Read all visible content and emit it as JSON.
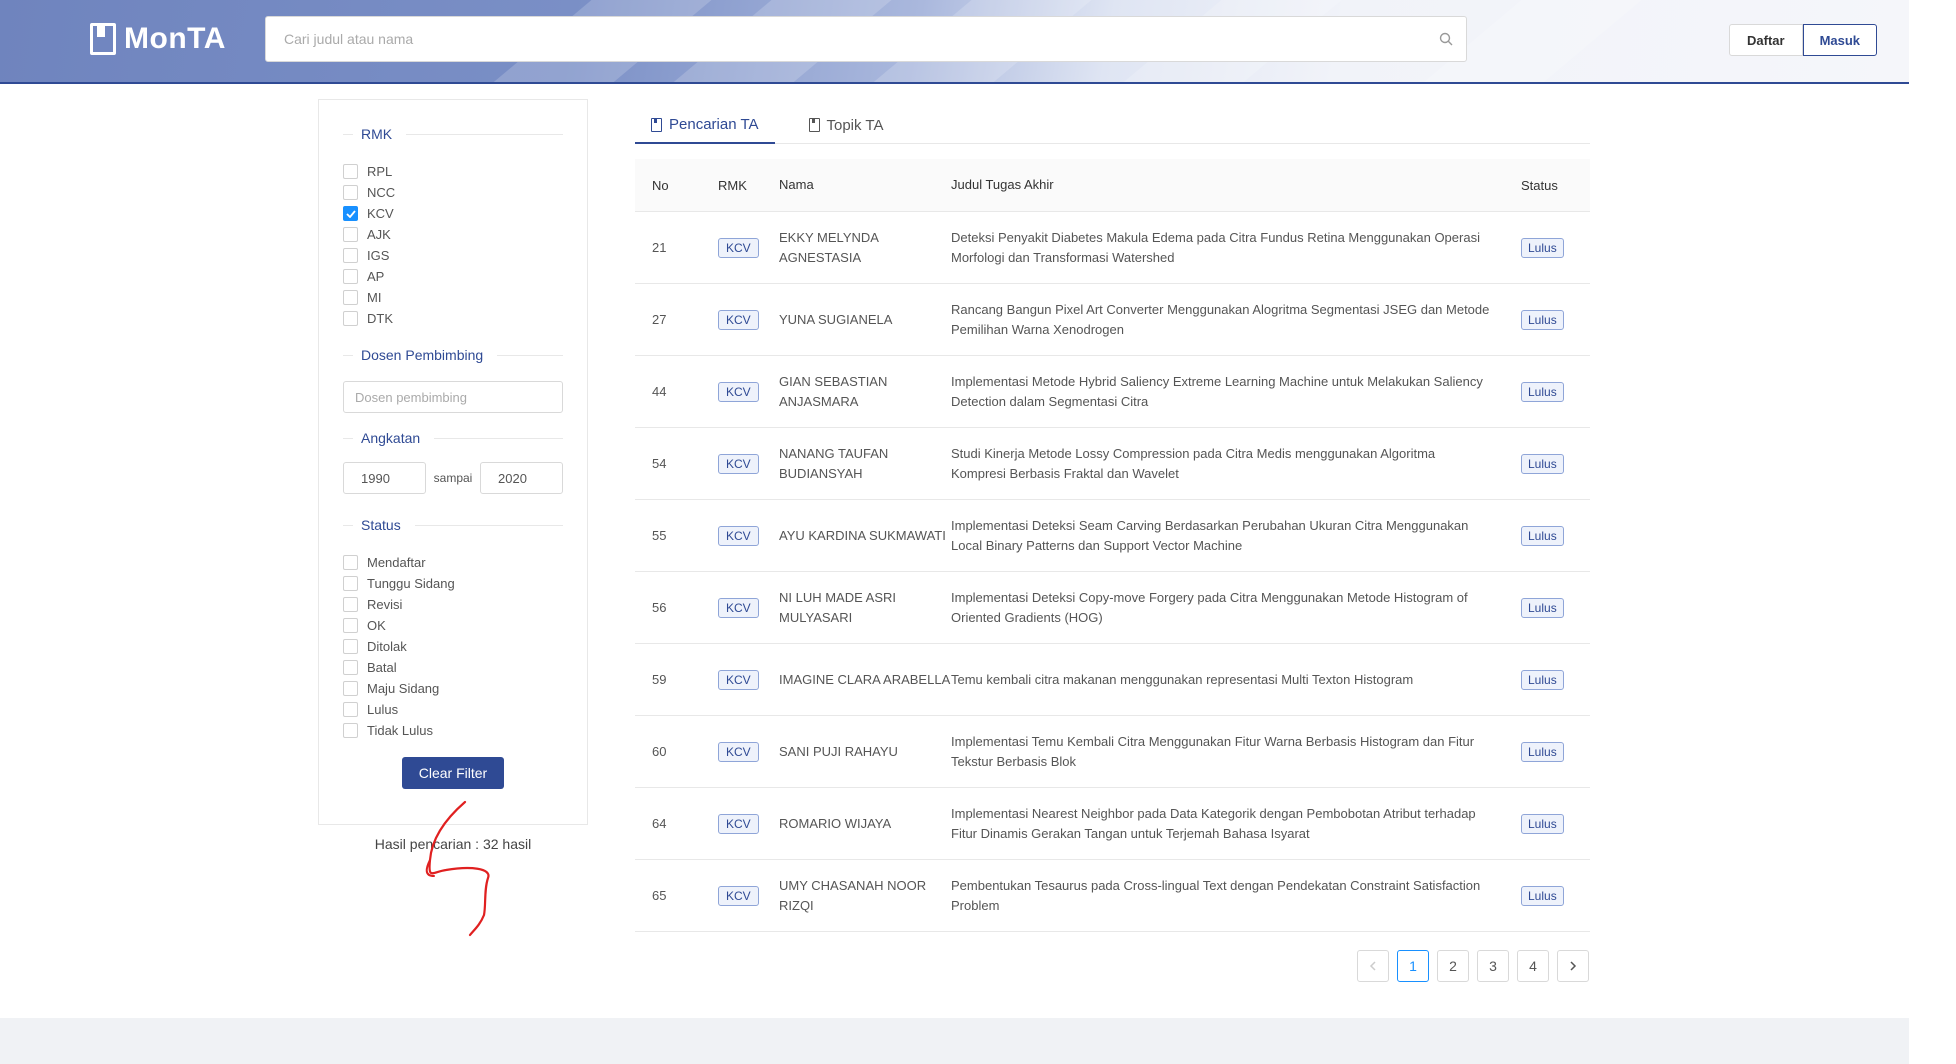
{
  "header": {
    "logo_text": "MonTA",
    "search_placeholder": "Cari judul atau nama",
    "daftar_label": "Daftar",
    "masuk_label": "Masuk"
  },
  "sidebar": {
    "rmk_title": "RMK",
    "rmk_options": [
      {
        "label": "RPL",
        "checked": false
      },
      {
        "label": "NCC",
        "checked": false
      },
      {
        "label": "KCV",
        "checked": true
      },
      {
        "label": "AJK",
        "checked": false
      },
      {
        "label": "IGS",
        "checked": false
      },
      {
        "label": "AP",
        "checked": false
      },
      {
        "label": "MI",
        "checked": false
      },
      {
        "label": "DTK",
        "checked": false
      }
    ],
    "dosen_title": "Dosen Pembimbing",
    "dosen_placeholder": "Dosen pembimbing",
    "angkatan_title": "Angkatan",
    "angkatan_from": "1990",
    "angkatan_sep": "sampai",
    "angkatan_to": "2020",
    "status_title": "Status",
    "status_options": [
      {
        "label": "Mendaftar",
        "checked": false
      },
      {
        "label": "Tunggu Sidang",
        "checked": false
      },
      {
        "label": "Revisi",
        "checked": false
      },
      {
        "label": "OK",
        "checked": false
      },
      {
        "label": "Ditolak",
        "checked": false
      },
      {
        "label": "Batal",
        "checked": false
      },
      {
        "label": "Maju Sidang",
        "checked": false
      },
      {
        "label": "Lulus",
        "checked": false
      },
      {
        "label": "Tidak Lulus",
        "checked": false
      }
    ],
    "clear_label": "Clear Filter",
    "result_text": "Hasil pencarian : 32 hasil"
  },
  "tabs": [
    {
      "label": "Pencarian TA",
      "active": true
    },
    {
      "label": "Topik TA",
      "active": false
    }
  ],
  "table": {
    "headers": {
      "no": "No",
      "rmk": "RMK",
      "nama": "Nama",
      "judul": "Judul Tugas Akhir",
      "status": "Status"
    },
    "rows": [
      {
        "no": "21",
        "rmk": "KCV",
        "nama": "EKKY MELYNDA AGNESTASIA",
        "judul": "Deteksi Penyakit Diabetes Makula Edema pada Citra Fundus Retina Menggunakan Operasi Morfologi dan Transformasi Watershed",
        "status": "Lulus"
      },
      {
        "no": "27",
        "rmk": "KCV",
        "nama": "YUNA SUGIANELA",
        "judul": "Rancang Bangun Pixel Art Converter Menggunakan Alogritma Segmentasi JSEG dan Metode Pemilihan Warna Xenodrogen",
        "status": "Lulus"
      },
      {
        "no": "44",
        "rmk": "KCV",
        "nama": "GIAN SEBASTIAN ANJASMARA",
        "judul": "Implementasi Metode Hybrid Saliency Extreme Learning Machine untuk Melakukan Saliency Detection dalam Segmentasi Citra",
        "status": "Lulus"
      },
      {
        "no": "54",
        "rmk": "KCV",
        "nama": "NANANG TAUFAN BUDIANSYAH",
        "judul": "Studi Kinerja Metode Lossy Compression pada Citra Medis menggunakan Algoritma Kompresi Berbasis Fraktal dan Wavelet",
        "status": "Lulus"
      },
      {
        "no": "55",
        "rmk": "KCV",
        "nama": "AYU KARDINA SUKMAWATI",
        "judul": "Implementasi Deteksi Seam Carving Berdasarkan Perubahan Ukuran Citra Menggunakan Local Binary Patterns dan Support Vector Machine",
        "status": "Lulus"
      },
      {
        "no": "56",
        "rmk": "KCV",
        "nama": "NI LUH MADE ASRI MULYASARI",
        "judul": "Implementasi Deteksi Copy-move Forgery pada Citra Menggunakan Metode Histogram of Oriented Gradients (HOG)",
        "status": "Lulus"
      },
      {
        "no": "59",
        "rmk": "KCV",
        "nama": "IMAGINE CLARA ARABELLA",
        "judul": "Temu kembali citra makanan menggunakan representasi Multi Texton Histogram",
        "status": "Lulus"
      },
      {
        "no": "60",
        "rmk": "KCV",
        "nama": "SANI PUJI RAHAYU",
        "judul": "Implementasi Temu Kembali Citra Menggunakan Fitur Warna Berbasis Histogram dan Fitur Tekstur Berbasis Blok",
        "status": "Lulus"
      },
      {
        "no": "64",
        "rmk": "KCV",
        "nama": "ROMARIO WIJAYA",
        "judul": "Implementasi Nearest Neighbor pada Data Kategorik dengan Pembobotan Atribut terhadap Fitur Dinamis Gerakan Tangan untuk Terjemah Bahasa Isyarat",
        "status": "Lulus"
      },
      {
        "no": "65",
        "rmk": "KCV",
        "nama": "UMY CHASANAH NOOR RIZQI",
        "judul": "Pembentukan Tesaurus pada Cross-lingual Text dengan Pendekatan Constraint Satisfaction Problem",
        "status": "Lulus"
      }
    ]
  },
  "pagination": {
    "prev_icon": "chevron-left-icon",
    "pages": [
      "1",
      "2",
      "3",
      "4"
    ],
    "current": "1",
    "next_icon": "chevron-right-icon"
  },
  "colors": {
    "primary": "#2f4a94",
    "checkbox_checked": "#1890ff",
    "annotation": "#e02020"
  }
}
